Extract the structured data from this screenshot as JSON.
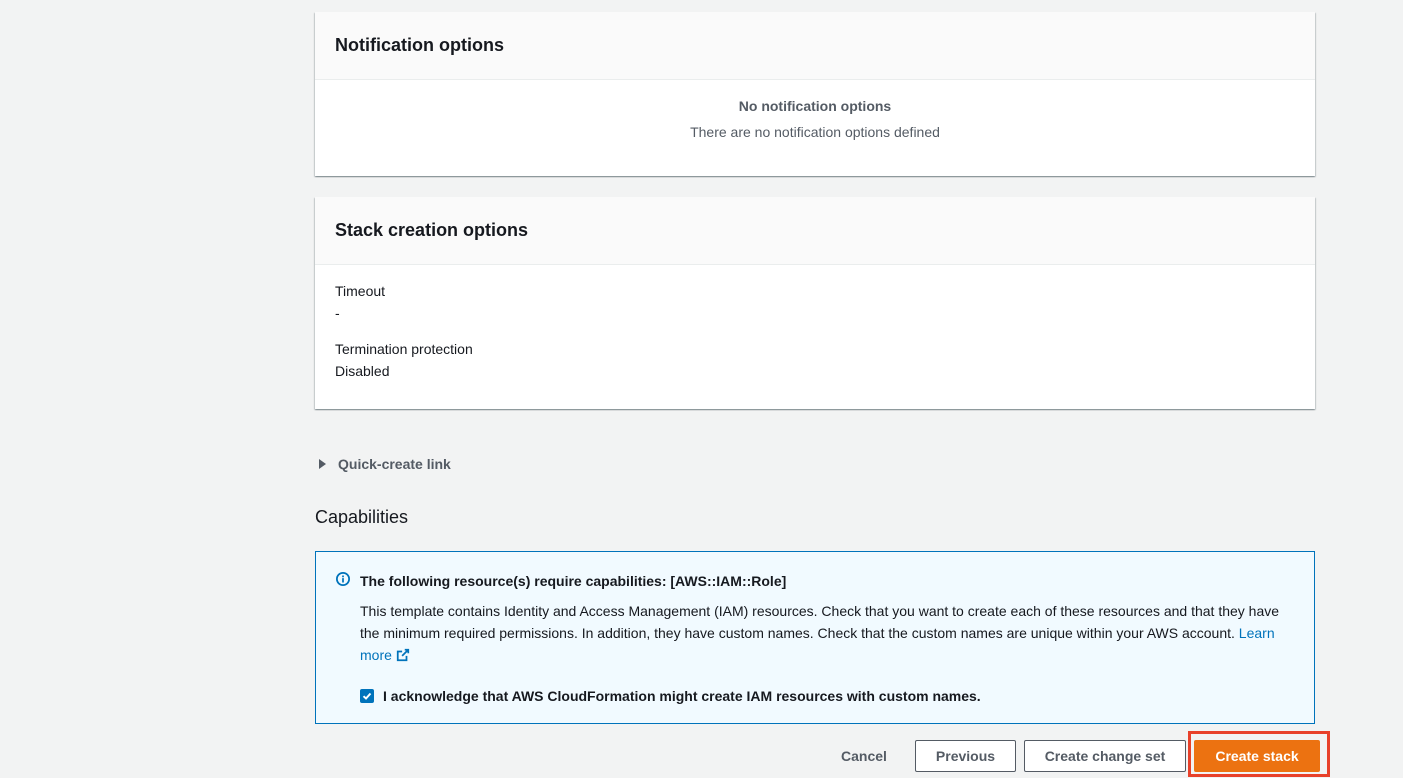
{
  "notification_panel": {
    "title": "Notification options",
    "empty_title": "No notification options",
    "empty_description": "There are no notification options defined"
  },
  "stack_creation_panel": {
    "title": "Stack creation options",
    "items": [
      {
        "key": "Timeout",
        "value": "-"
      },
      {
        "key": "Termination protection",
        "value": "Disabled"
      }
    ]
  },
  "quick_create": {
    "label": "Quick-create link"
  },
  "capabilities": {
    "title": "Capabilities",
    "alert_title": "The following resource(s) require capabilities: [AWS::IAM::Role]",
    "alert_body": "This template contains Identity and Access Management (IAM) resources. Check that you want to create each of these resources and that they have the minimum required permissions. In addition, they have custom names. Check that the custom names are unique within your AWS account.",
    "learn_more": "Learn more",
    "acknowledge_label": "I acknowledge that AWS CloudFormation might create IAM resources with custom names.",
    "acknowledge_checked": true
  },
  "footer": {
    "cancel": "Cancel",
    "previous": "Previous",
    "create_change_set": "Create change set",
    "create_stack": "Create stack"
  },
  "colors": {
    "primary": "#ec7211",
    "link": "#0073bb",
    "highlight": "#e8412a",
    "info_background": "#f1faff"
  }
}
